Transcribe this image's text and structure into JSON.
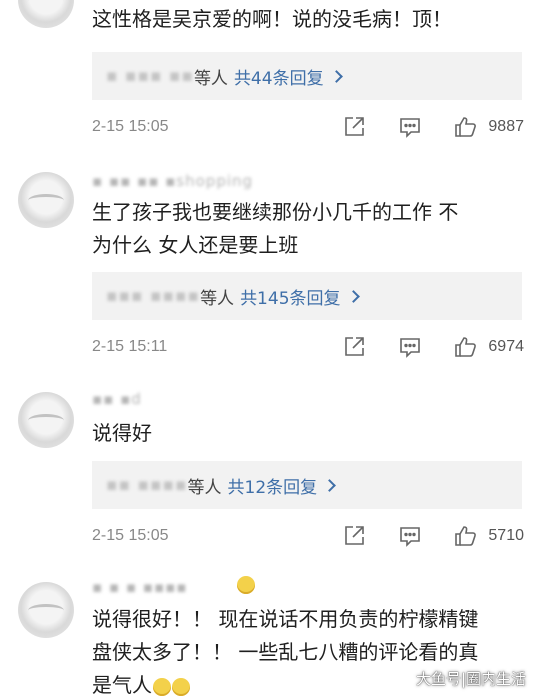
{
  "comments": [
    {
      "username": "",
      "text_lines": [
        "这性格是吴京爱的啊！说的没毛病！顶！"
      ],
      "reply_names": "▪ ▪▪▪ ▪▪",
      "reply_suffix": "等人",
      "reply_count": "共44条回复",
      "time": "2-15 15:05",
      "likes": "9887"
    },
    {
      "username": "▪ ▪▪ ▪▪ ▪shopping",
      "text_lines": [
        "生了孩子我也要继续那份小几千的工作 不",
        "为什么 女人还是要上班"
      ],
      "reply_names": "▪▪▪ ▪▪▪▪",
      "reply_suffix": "等人",
      "reply_count": "共145条回复",
      "time": "2-15 15:11",
      "likes": "6974"
    },
    {
      "username": "▪▪ ▪d",
      "text_lines": [
        "说得好"
      ],
      "reply_names": "▪▪ ▪▪▪▪",
      "reply_suffix": "等人",
      "reply_count": "共12条回复",
      "time": "2-15 15:05",
      "likes": "5710"
    },
    {
      "username": "▪ ▪ ▪ ▪▪▪▪",
      "text_lines": [
        "说得很好！！ 现在说话不用负责的柠檬精键",
        "盘侠太多了！！ 一些乱七八糟的评论看的真",
        "是气人"
      ]
    }
  ],
  "watermark": "大鱼号|圈内生活",
  "colors": {
    "link_blue": "#3f6fa8",
    "reply_bg": "#f2f2f2",
    "meta_gray": "#888888"
  },
  "icons": {
    "share": "share-icon",
    "comment": "comment-icon",
    "like": "thumbs-up-icon"
  }
}
